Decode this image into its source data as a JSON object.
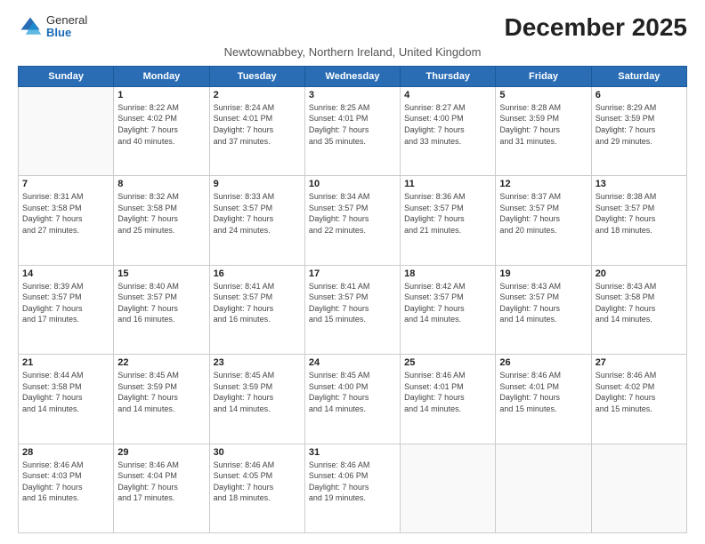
{
  "logo": {
    "general": "General",
    "blue": "Blue"
  },
  "header": {
    "month": "December 2025",
    "location": "Newtownabbey, Northern Ireland, United Kingdom"
  },
  "weekdays": [
    "Sunday",
    "Monday",
    "Tuesday",
    "Wednesday",
    "Thursday",
    "Friday",
    "Saturday"
  ],
  "weeks": [
    [
      {
        "day": "",
        "info": ""
      },
      {
        "day": "1",
        "info": "Sunrise: 8:22 AM\nSunset: 4:02 PM\nDaylight: 7 hours\nand 40 minutes."
      },
      {
        "day": "2",
        "info": "Sunrise: 8:24 AM\nSunset: 4:01 PM\nDaylight: 7 hours\nand 37 minutes."
      },
      {
        "day": "3",
        "info": "Sunrise: 8:25 AM\nSunset: 4:01 PM\nDaylight: 7 hours\nand 35 minutes."
      },
      {
        "day": "4",
        "info": "Sunrise: 8:27 AM\nSunset: 4:00 PM\nDaylight: 7 hours\nand 33 minutes."
      },
      {
        "day": "5",
        "info": "Sunrise: 8:28 AM\nSunset: 3:59 PM\nDaylight: 7 hours\nand 31 minutes."
      },
      {
        "day": "6",
        "info": "Sunrise: 8:29 AM\nSunset: 3:59 PM\nDaylight: 7 hours\nand 29 minutes."
      }
    ],
    [
      {
        "day": "7",
        "info": "Sunrise: 8:31 AM\nSunset: 3:58 PM\nDaylight: 7 hours\nand 27 minutes."
      },
      {
        "day": "8",
        "info": "Sunrise: 8:32 AM\nSunset: 3:58 PM\nDaylight: 7 hours\nand 25 minutes."
      },
      {
        "day": "9",
        "info": "Sunrise: 8:33 AM\nSunset: 3:57 PM\nDaylight: 7 hours\nand 24 minutes."
      },
      {
        "day": "10",
        "info": "Sunrise: 8:34 AM\nSunset: 3:57 PM\nDaylight: 7 hours\nand 22 minutes."
      },
      {
        "day": "11",
        "info": "Sunrise: 8:36 AM\nSunset: 3:57 PM\nDaylight: 7 hours\nand 21 minutes."
      },
      {
        "day": "12",
        "info": "Sunrise: 8:37 AM\nSunset: 3:57 PM\nDaylight: 7 hours\nand 20 minutes."
      },
      {
        "day": "13",
        "info": "Sunrise: 8:38 AM\nSunset: 3:57 PM\nDaylight: 7 hours\nand 18 minutes."
      }
    ],
    [
      {
        "day": "14",
        "info": "Sunrise: 8:39 AM\nSunset: 3:57 PM\nDaylight: 7 hours\nand 17 minutes."
      },
      {
        "day": "15",
        "info": "Sunrise: 8:40 AM\nSunset: 3:57 PM\nDaylight: 7 hours\nand 16 minutes."
      },
      {
        "day": "16",
        "info": "Sunrise: 8:41 AM\nSunset: 3:57 PM\nDaylight: 7 hours\nand 16 minutes."
      },
      {
        "day": "17",
        "info": "Sunrise: 8:41 AM\nSunset: 3:57 PM\nDaylight: 7 hours\nand 15 minutes."
      },
      {
        "day": "18",
        "info": "Sunrise: 8:42 AM\nSunset: 3:57 PM\nDaylight: 7 hours\nand 14 minutes."
      },
      {
        "day": "19",
        "info": "Sunrise: 8:43 AM\nSunset: 3:57 PM\nDaylight: 7 hours\nand 14 minutes."
      },
      {
        "day": "20",
        "info": "Sunrise: 8:43 AM\nSunset: 3:58 PM\nDaylight: 7 hours\nand 14 minutes."
      }
    ],
    [
      {
        "day": "21",
        "info": "Sunrise: 8:44 AM\nSunset: 3:58 PM\nDaylight: 7 hours\nand 14 minutes."
      },
      {
        "day": "22",
        "info": "Sunrise: 8:45 AM\nSunset: 3:59 PM\nDaylight: 7 hours\nand 14 minutes."
      },
      {
        "day": "23",
        "info": "Sunrise: 8:45 AM\nSunset: 3:59 PM\nDaylight: 7 hours\nand 14 minutes."
      },
      {
        "day": "24",
        "info": "Sunrise: 8:45 AM\nSunset: 4:00 PM\nDaylight: 7 hours\nand 14 minutes."
      },
      {
        "day": "25",
        "info": "Sunrise: 8:46 AM\nSunset: 4:01 PM\nDaylight: 7 hours\nand 14 minutes."
      },
      {
        "day": "26",
        "info": "Sunrise: 8:46 AM\nSunset: 4:01 PM\nDaylight: 7 hours\nand 15 minutes."
      },
      {
        "day": "27",
        "info": "Sunrise: 8:46 AM\nSunset: 4:02 PM\nDaylight: 7 hours\nand 15 minutes."
      }
    ],
    [
      {
        "day": "28",
        "info": "Sunrise: 8:46 AM\nSunset: 4:03 PM\nDaylight: 7 hours\nand 16 minutes."
      },
      {
        "day": "29",
        "info": "Sunrise: 8:46 AM\nSunset: 4:04 PM\nDaylight: 7 hours\nand 17 minutes."
      },
      {
        "day": "30",
        "info": "Sunrise: 8:46 AM\nSunset: 4:05 PM\nDaylight: 7 hours\nand 18 minutes."
      },
      {
        "day": "31",
        "info": "Sunrise: 8:46 AM\nSunset: 4:06 PM\nDaylight: 7 hours\nand 19 minutes."
      },
      {
        "day": "",
        "info": ""
      },
      {
        "day": "",
        "info": ""
      },
      {
        "day": "",
        "info": ""
      }
    ]
  ]
}
